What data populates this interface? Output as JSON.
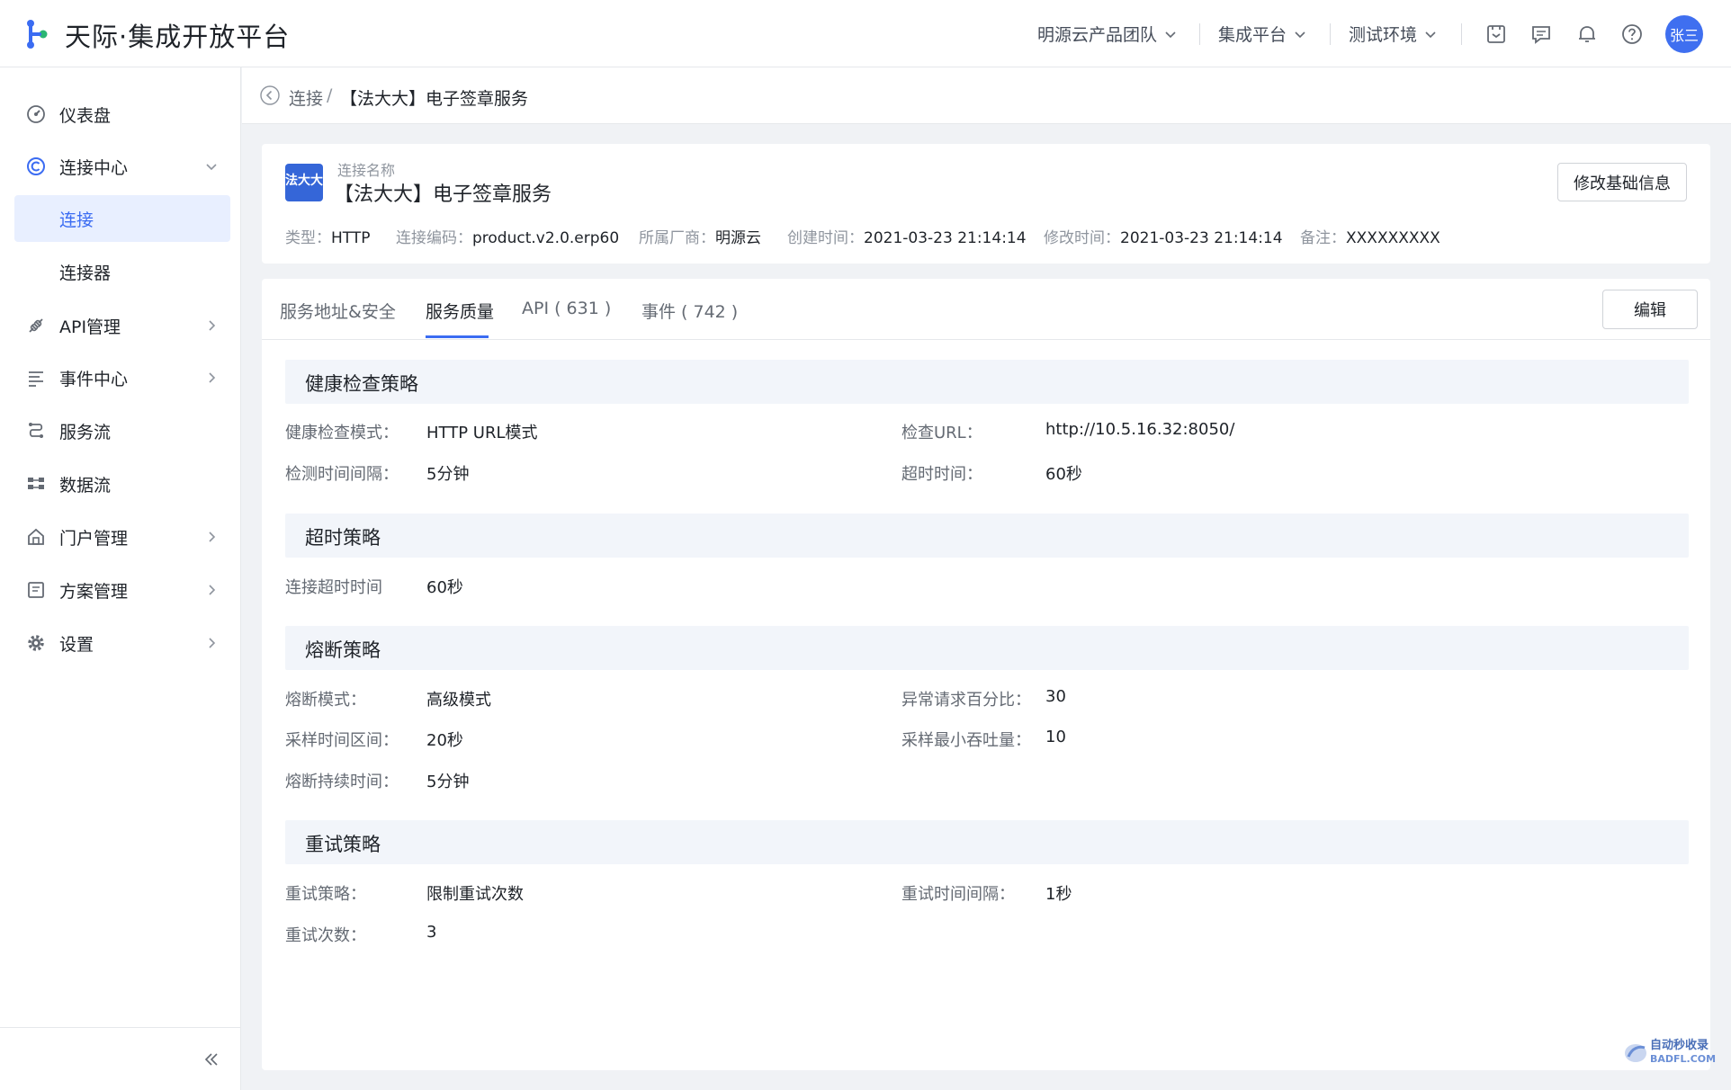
{
  "app": {
    "title": "天际·集成开放平台"
  },
  "header": {
    "menus": [
      {
        "label": "明源云产品团队"
      },
      {
        "label": "集成平台"
      },
      {
        "label": "测试环境"
      }
    ],
    "avatar": "张三"
  },
  "sidebar": {
    "items": [
      {
        "label": "仪表盘",
        "icon": "dashboard-icon"
      },
      {
        "label": "连接中心",
        "icon": "connection-center-icon"
      },
      {
        "label": "连接"
      },
      {
        "label": "连接器"
      },
      {
        "label": "API管理",
        "icon": "api-icon"
      },
      {
        "label": "事件中心",
        "icon": "event-icon"
      },
      {
        "label": "服务流",
        "icon": "service-flow-icon"
      },
      {
        "label": "数据流",
        "icon": "data-flow-icon"
      },
      {
        "label": "门户管理",
        "icon": "portal-icon"
      },
      {
        "label": "方案管理",
        "icon": "plan-icon"
      },
      {
        "label": "设置",
        "icon": "settings-icon"
      }
    ]
  },
  "breadcrumb": {
    "parent": "连接",
    "separator": "/",
    "current": "【法大大】电子签章服务"
  },
  "info": {
    "logo_text": "法大大",
    "name_label": "连接名称",
    "name_value": "【法大大】电子签章服务",
    "edit_button": "修改基础信息",
    "meta": [
      {
        "key": "类型：",
        "value": "HTTP"
      },
      {
        "key": "连接编码：",
        "value": "product.v2.0.erp60"
      },
      {
        "key": "所属厂商：",
        "value": "明源云"
      },
      {
        "key": "创建时间：",
        "value": "2021-03-23 21:14:14"
      },
      {
        "key": "修改时间：",
        "value": "2021-03-23 21:14:14"
      },
      {
        "key": "备注：",
        "value": "XXXXXXXXX"
      }
    ]
  },
  "tabs": [
    {
      "label": "服务地址&安全"
    },
    {
      "label": "服务质量"
    },
    {
      "label": "API ( 631 )"
    },
    {
      "label": "事件 ( 742 )"
    }
  ],
  "edit_button": "编辑",
  "sections": {
    "health": {
      "title": "健康检查策略",
      "fields": [
        {
          "key": "健康检查模式：",
          "value": "HTTP URL模式"
        },
        {
          "key": "检查URL：",
          "value": "http://10.5.16.32:8050/"
        },
        {
          "key": "检测时间间隔：",
          "value": "5分钟"
        },
        {
          "key": "超时时间：",
          "value": "60秒"
        }
      ]
    },
    "timeout": {
      "title": "超时策略",
      "fields": [
        {
          "key": "连接超时时间",
          "value": "60秒"
        }
      ]
    },
    "breaker": {
      "title": "熔断策略",
      "fields": [
        {
          "key": "熔断模式：",
          "value": "高级模式"
        },
        {
          "key": "异常请求百分比：",
          "value": "30"
        },
        {
          "key": "采样时间区间：",
          "value": "20秒"
        },
        {
          "key": "采样最小吞吐量：",
          "value": "10"
        },
        {
          "key": "熔断持续时间：",
          "value": "5分钟"
        }
      ]
    },
    "retry": {
      "title": "重试策略",
      "fields": [
        {
          "key": "重试策略：",
          "value": "限制重试次数"
        },
        {
          "key": "重试时间间隔：",
          "value": "1秒"
        },
        {
          "key": "重试次数：",
          "value": "3"
        }
      ]
    }
  },
  "watermark": {
    "line1": "自动秒收录",
    "line2": "BADFL.COM"
  },
  "colors": {
    "accent": "#3b6cf2",
    "avatar": "#3f6ff0",
    "active_bg": "#e8efff",
    "section_bg": "#f2f5fa"
  }
}
